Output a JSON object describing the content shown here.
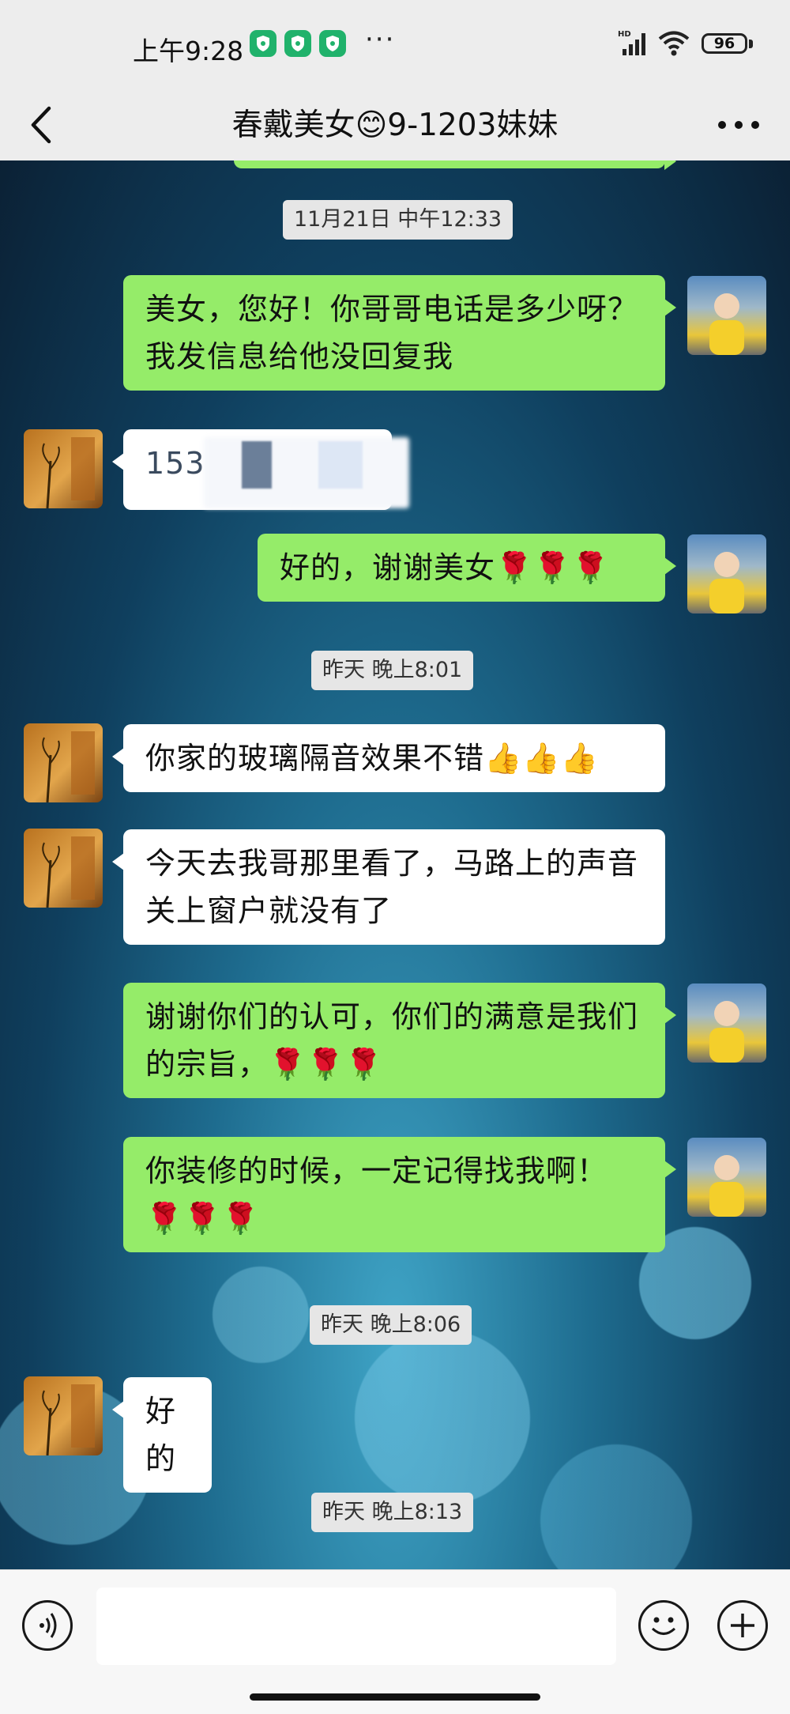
{
  "status_bar": {
    "time": "上午9:28",
    "battery": "96",
    "network": "HD",
    "dots": "···"
  },
  "header": {
    "back_icon": "chevron-left-icon",
    "title": "春戴美女😊9-1203妹妹",
    "more_icon": "more-dots-icon"
  },
  "messages": [
    {
      "type": "timestamp",
      "text": "11月21日 中午12:33"
    },
    {
      "type": "sent",
      "text": "美女，您好！你哥哥电话是多少呀？我发信息给他没回复我"
    },
    {
      "type": "received",
      "text": "153"
    },
    {
      "type": "sent",
      "text": "好的，谢谢美女🌹🌹🌹"
    },
    {
      "type": "timestamp",
      "text": "昨天 晚上8:01"
    },
    {
      "type": "received",
      "text": "你家的玻璃隔音效果不错👍👍👍"
    },
    {
      "type": "received",
      "text": "今天去我哥那里看了，马路上的声音关上窗户就没有了"
    },
    {
      "type": "sent",
      "text": "谢谢你们的认可，你们的满意是我们的宗旨，🌹🌹🌹"
    },
    {
      "type": "sent",
      "text": "你装修的时候，一定记得找我啊！🌹🌹🌹"
    },
    {
      "type": "timestamp",
      "text": "昨天 晚上8:06"
    },
    {
      "type": "received",
      "text": "好的"
    },
    {
      "type": "timestamp",
      "text": "昨天 晚上8:13"
    }
  ],
  "input_bar": {
    "voice_icon": "voice-icon",
    "input_value": "",
    "emoji_icon": "emoji-icon",
    "add_icon": "plus-icon"
  },
  "colors": {
    "sent_bubble": "#95ec69",
    "received_bubble": "#ffffff",
    "header_bg": "#ededed"
  }
}
